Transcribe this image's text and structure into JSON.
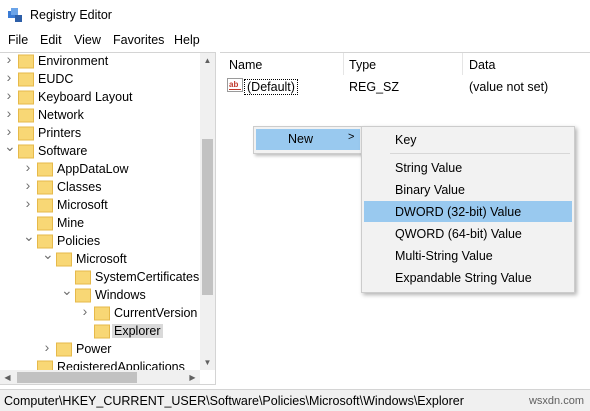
{
  "window": {
    "title": "Registry Editor"
  },
  "menu": [
    "File",
    "Edit",
    "View",
    "Favorites",
    "Help"
  ],
  "tree": [
    {
      "label": "Environment",
      "chevron": ">",
      "selected": false
    },
    {
      "label": "EUDC",
      "chevron": ">",
      "selected": false
    },
    {
      "label": "Keyboard Layout",
      "chevron": ">",
      "selected": false
    },
    {
      "label": "Network",
      "chevron": ">",
      "selected": false
    },
    {
      "label": "Printers",
      "chevron": ">",
      "selected": false
    },
    {
      "label": "Software",
      "chevron": "v",
      "selected": false
    },
    {
      "label": "AppDataLow",
      "chevron": ">",
      "selected": false
    },
    {
      "label": "Classes",
      "chevron": ">",
      "selected": false
    },
    {
      "label": "Microsoft",
      "chevron": ">",
      "selected": false
    },
    {
      "label": "Mine",
      "chevron": "",
      "selected": false
    },
    {
      "label": "Policies",
      "chevron": "v",
      "selected": false
    },
    {
      "label": "Microsoft",
      "chevron": "v",
      "selected": false
    },
    {
      "label": "SystemCertificates",
      "chevron": "",
      "selected": false
    },
    {
      "label": "Windows",
      "chevron": "v",
      "selected": false
    },
    {
      "label": "CurrentVersion",
      "chevron": ">",
      "selected": false
    },
    {
      "label": "Explorer",
      "chevron": "",
      "selected": true
    },
    {
      "label": "Power",
      "chevron": ">",
      "selected": false
    },
    {
      "label": "RegisteredApplications",
      "chevron": "",
      "selected": false
    }
  ],
  "columns": {
    "name": "Name",
    "type": "Type",
    "data": "Data"
  },
  "values": [
    {
      "name": "(Default)",
      "type": "REG_SZ",
      "data": "(value not set)",
      "icon": "string-value-icon"
    }
  ],
  "context_menu": {
    "label": "New",
    "arrow": ">"
  },
  "submenu": [
    {
      "label": "Key",
      "highlighted": false
    },
    {
      "label": "String Value",
      "highlighted": false
    },
    {
      "label": "Binary Value",
      "highlighted": false
    },
    {
      "label": "DWORD (32-bit) Value",
      "highlighted": true
    },
    {
      "label": "QWORD (64-bit) Value",
      "highlighted": false
    },
    {
      "label": "Multi-String Value",
      "highlighted": false
    },
    {
      "label": "Expandable String Value",
      "highlighted": false
    }
  ],
  "status": {
    "path": "Computer\\HKEY_CURRENT_USER\\Software\\Policies\\Microsoft\\Windows\\Explorer"
  },
  "watermark": "wsxdn.com",
  "colors": {
    "folder": "#f8d775",
    "folder_dark": "#e6b94a",
    "highlight": "#99c9ef",
    "selected": "#d9d9d9"
  }
}
